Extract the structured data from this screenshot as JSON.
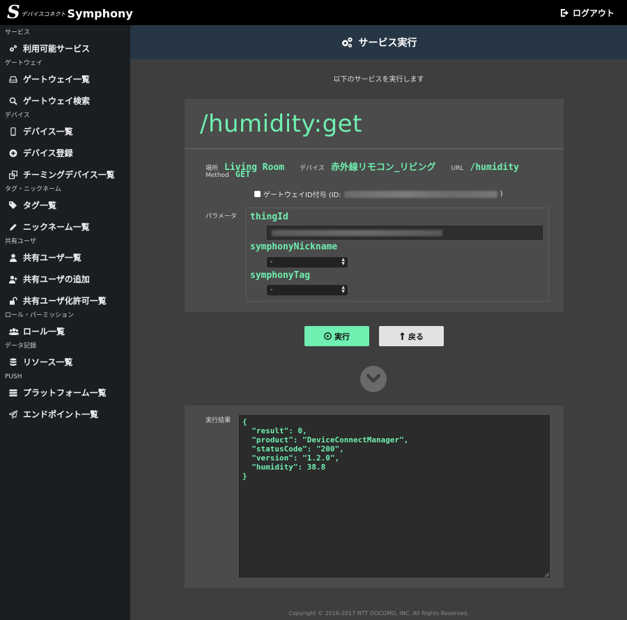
{
  "app": {
    "logo_letter": "S",
    "logo_sub": "デバイスコネクト",
    "logo_name": "Symphony",
    "logout_label": "ログアウト"
  },
  "sidebar": {
    "sections": [
      {
        "label": "サービス",
        "items": [
          {
            "label": "利用可能サービス",
            "icon": "gears-icon"
          }
        ]
      },
      {
        "label": "ゲートウェイ",
        "items": [
          {
            "label": "ゲートウェイ一覧",
            "icon": "hdd-icon"
          },
          {
            "label": "ゲートウェイ検索",
            "icon": "search-icon"
          }
        ]
      },
      {
        "label": "デバイス",
        "items": [
          {
            "label": "デバイス一覧",
            "icon": "mobile-icon"
          },
          {
            "label": "デバイス登録",
            "icon": "plus-circle-icon"
          },
          {
            "label": "チーミングデバイス一覧",
            "icon": "clone-icon"
          }
        ]
      },
      {
        "label": "タグ・ニックネーム",
        "items": [
          {
            "label": "タグ一覧",
            "icon": "tags-icon"
          },
          {
            "label": "ニックネーム一覧",
            "icon": "pencil-icon"
          }
        ]
      },
      {
        "label": "共有ユーザ",
        "items": [
          {
            "label": "共有ユーザ一覧",
            "icon": "user-icon"
          },
          {
            "label": "共有ユーザの追加",
            "icon": "user-plus-icon"
          },
          {
            "label": "共有ユーザ化許可一覧",
            "icon": "unlock-icon"
          }
        ]
      },
      {
        "label": "ロール・パーミッション",
        "items": [
          {
            "label": "ロール一覧",
            "icon": "users-icon"
          }
        ]
      },
      {
        "label": "データ記録",
        "items": [
          {
            "label": "リソース一覧",
            "icon": "database-icon"
          }
        ]
      },
      {
        "label": "PUSH",
        "items": [
          {
            "label": "プラットフォーム一覧",
            "icon": "server-icon"
          },
          {
            "label": "エンドポイント一覧",
            "icon": "paper-plane-icon"
          }
        ]
      }
    ]
  },
  "header": {
    "title": "サービス実行",
    "icon": "gears-icon"
  },
  "main": {
    "subtitle": "以下のサービスを実行します",
    "service_path": "/humidity:get",
    "location_label": "場所",
    "location_value": "Living Room",
    "device_label": "デバイス",
    "device_value": "赤外線リモコン_リビング",
    "url_label": "URL",
    "url_value": "/humidity",
    "method_label": "Method",
    "method_value": "GET",
    "gateway_checkbox_label": "ゲートウェイID付与 (ID:",
    "gateway_checkbox_close": ")",
    "params_label": "パラメータ",
    "params": [
      {
        "name": "thingId",
        "type": "text"
      },
      {
        "name": "symphonyNickname",
        "type": "select",
        "value": "-"
      },
      {
        "name": "symphonyTag",
        "type": "select",
        "value": "-"
      }
    ],
    "run_button": "実行",
    "back_button": "戻る",
    "result_label": "実行結果",
    "result_text": "{\n  \"result\": 0,\n  \"product\": \"DeviceConnectManager\",\n  \"statusCode\": \"200\",\n  \"version\": \"1.2.0\",\n  \"humidity\": 38.8\n}",
    "copyright": "Copyright © 2016-2017 NTT DOCOMO, INC. All Rights Reserved."
  },
  "colors": {
    "accent": "#6ff0b0",
    "header_bg": "#263645",
    "sidebar_bg": "#1a1e23",
    "card_bg": "#4b4b4b"
  }
}
